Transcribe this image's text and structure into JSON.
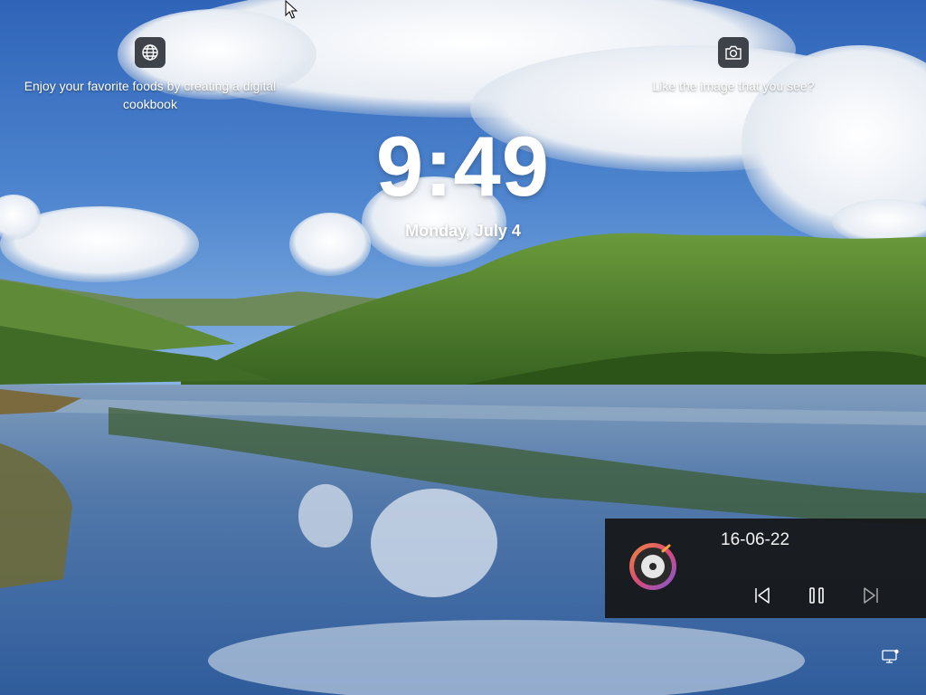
{
  "spotlight_left": {
    "icon": "globe-icon",
    "text": "Enjoy your favorite foods by creating a digital cookbook"
  },
  "spotlight_right": {
    "icon": "camera-icon",
    "text": "Like the image that you see?"
  },
  "lock": {
    "time": "9:49",
    "date": "Monday, July 4"
  },
  "media": {
    "title": "16-06-22",
    "icons": [
      "app-disc-icon",
      "previous-icon",
      "pause-icon",
      "next-icon"
    ]
  },
  "system_tray": {
    "icon": "network-icon"
  },
  "colors": {
    "sky": "#3f78c8",
    "water": "#35609e",
    "forest": "#3d6a24",
    "media_panel": "#161616"
  }
}
